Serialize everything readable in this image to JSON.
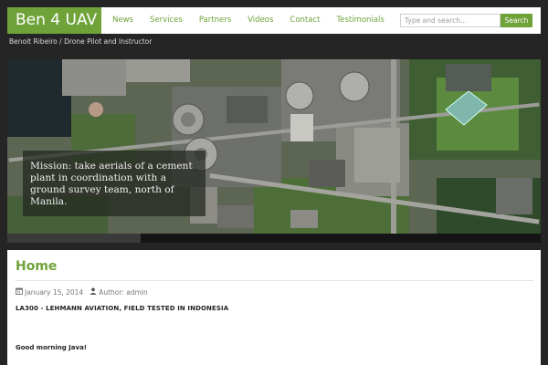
{
  "site": {
    "logo": "Ben 4 UAV",
    "tagline": "Benoit Ribeiro / Drone Pilot and Instructor"
  },
  "nav": {
    "items": [
      "News",
      "Services",
      "Partners",
      "Videos",
      "Contact",
      "Testimonials"
    ]
  },
  "search": {
    "placeholder": "Type and search...",
    "button_label": "Search"
  },
  "hero": {
    "caption": "Mission: take aerials of a cement plant in coordination with a ground survey team, north of Manila."
  },
  "content": {
    "title": "Home",
    "date": "January 15, 2014",
    "author_label": "Author: admin",
    "post_heading": "LA300 - LEHMANN AVIATION, FIELD TESTED IN INDONESIA",
    "post_text": "Good morning Java!"
  },
  "colors": {
    "accent": "#6fa33a",
    "page_background": "#252525"
  },
  "icons": {
    "date": "calendar-icon",
    "author": "user-icon"
  }
}
